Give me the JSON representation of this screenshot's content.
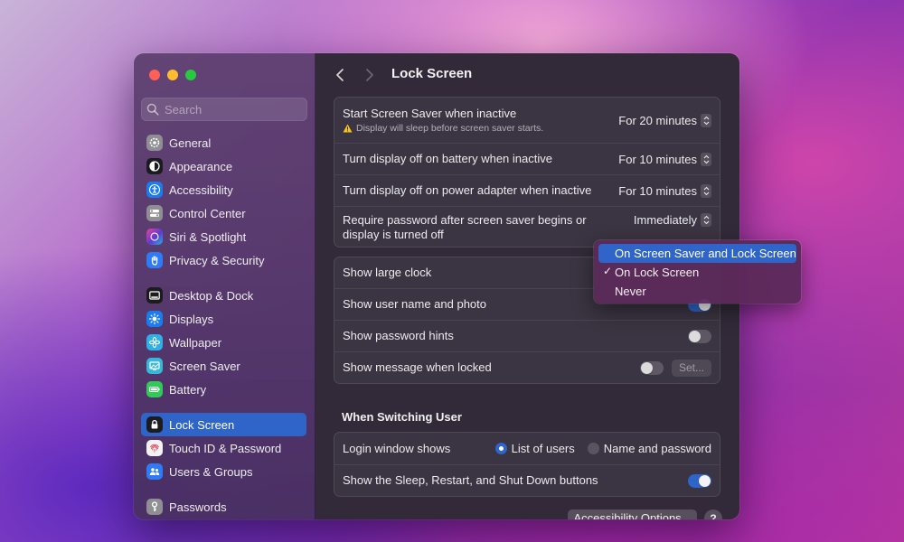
{
  "sidebar": {
    "search_placeholder": "Search",
    "items": [
      {
        "label": "General",
        "icon": "gear-icon",
        "color": "#8e8e93"
      },
      {
        "label": "Appearance",
        "icon": "appearance-icon",
        "color": "#1c1c1e"
      },
      {
        "label": "Accessibility",
        "icon": "accessibility-icon",
        "color": "#1b7cf0"
      },
      {
        "label": "Control Center",
        "icon": "control-center-icon",
        "color": "#8e8e93"
      },
      {
        "label": "Siri & Spotlight",
        "icon": "siri-icon",
        "color": "#5e3bd1"
      },
      {
        "label": "Privacy & Security",
        "icon": "hand-icon",
        "color": "#2f7bf6"
      },
      {
        "label": "Desktop & Dock",
        "icon": "dock-icon",
        "color": "#1c1c1e"
      },
      {
        "label": "Displays",
        "icon": "sun-icon",
        "color": "#1b7cf0"
      },
      {
        "label": "Wallpaper",
        "icon": "flower-icon",
        "color": "#30b0e8"
      },
      {
        "label": "Screen Saver",
        "icon": "screen-saver-icon",
        "color": "#38b7d9"
      },
      {
        "label": "Battery",
        "icon": "battery-icon",
        "color": "#34c759"
      },
      {
        "label": "Lock Screen",
        "icon": "lock-icon",
        "color": "#1c1c1e"
      },
      {
        "label": "Touch ID & Password",
        "icon": "fingerprint-icon",
        "color": "#f2f2f2"
      },
      {
        "label": "Users & Groups",
        "icon": "users-icon",
        "color": "#2f7bf6"
      },
      {
        "label": "Passwords",
        "icon": "key-icon",
        "color": "#8e8e93"
      }
    ],
    "active_index": 11
  },
  "header": {
    "title": "Lock Screen"
  },
  "group1": {
    "rows": [
      {
        "label": "Start Screen Saver when inactive",
        "sub": "Display will sleep before screen saver starts.",
        "value": "For 20 minutes"
      },
      {
        "label": "Turn display off on battery when inactive",
        "value": "For 10 minutes"
      },
      {
        "label": "Turn display off on power adapter when inactive",
        "value": "For 10 minutes"
      },
      {
        "label_line1": "Require password after screen saver begins or",
        "label_line2": "display is turned off",
        "value": "Immediately"
      }
    ]
  },
  "group2": {
    "rows": [
      {
        "label": "Show large clock"
      },
      {
        "label": "Show user name and photo",
        "toggle": true
      },
      {
        "label": "Show password hints",
        "toggle": false
      },
      {
        "label": "Show message when locked",
        "toggle": false,
        "button": "Set..."
      }
    ]
  },
  "switching": {
    "title": "When Switching User",
    "login_label": "Login window shows",
    "option_list": "List of users",
    "option_name": "Name and password",
    "selected": "List of users",
    "buttons_label": "Show the Sleep, Restart, and Shut Down buttons",
    "buttons_toggle": true
  },
  "footer": {
    "accessibility_button": "Accessibility Options...",
    "help": "?"
  },
  "dropdown": {
    "items": [
      "On Screen Saver and Lock Screen",
      "On Lock Screen",
      "Never"
    ],
    "checked": "On Lock Screen",
    "highlighted": "On Screen Saver and Lock Screen"
  },
  "colors": {
    "accent": "#2f64c8",
    "warning": "#f5c518"
  }
}
